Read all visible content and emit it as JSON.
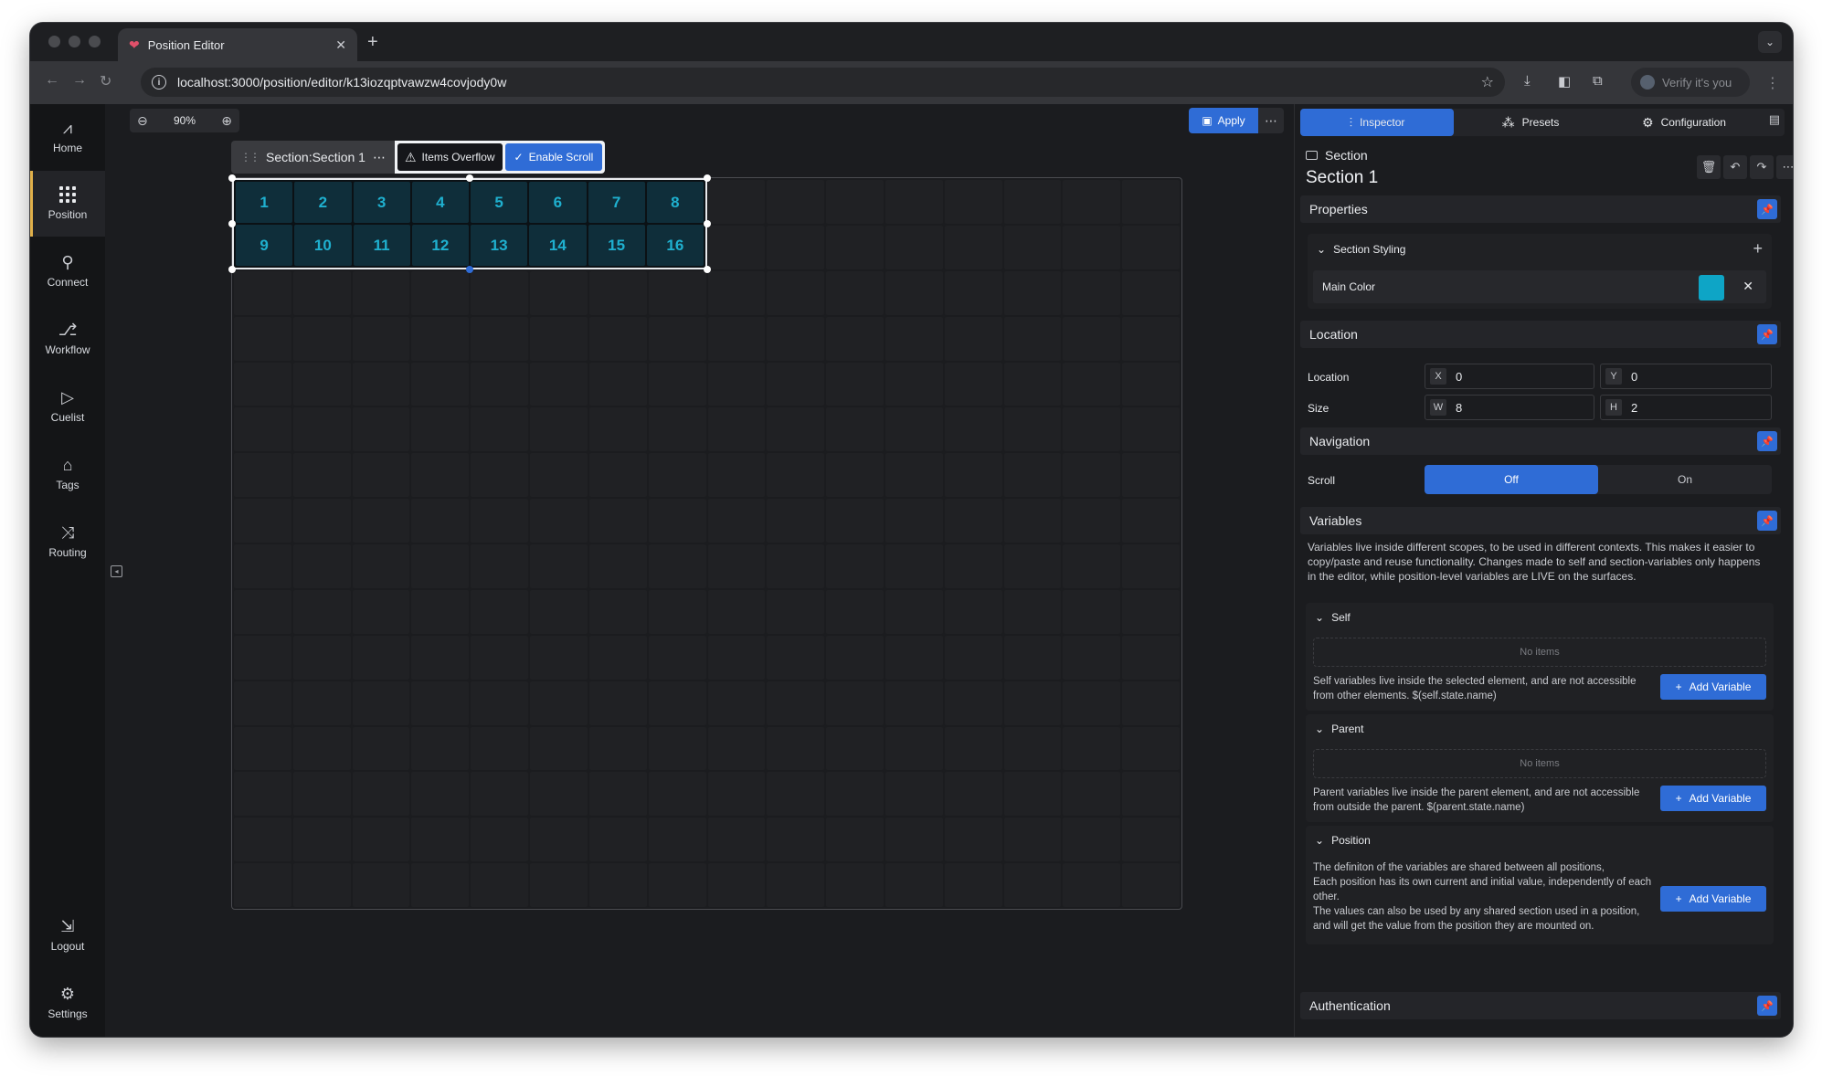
{
  "browser": {
    "tab_title": "Position Editor",
    "url": "localhost:3000/position/editor/k13iozqptvawzw4covjody0w",
    "verify_label": "Verify it's you"
  },
  "rail": {
    "items": [
      {
        "label": "Home",
        "icon": "pulse-icon"
      },
      {
        "label": "Position",
        "icon": "grid-icon"
      },
      {
        "label": "Connect",
        "icon": "plug-icon"
      },
      {
        "label": "Workflow",
        "icon": "workflow-icon"
      },
      {
        "label": "Cuelist",
        "icon": "play-icon"
      },
      {
        "label": "Tags",
        "icon": "tag-icon"
      },
      {
        "label": "Routing",
        "icon": "shuffle-icon"
      }
    ],
    "bottom": [
      {
        "label": "Logout",
        "icon": "logout-icon"
      },
      {
        "label": "Settings",
        "icon": "gear-icon"
      }
    ],
    "active": "Position",
    "active_color": "#e0b04a"
  },
  "canvas": {
    "zoom": "90%",
    "apply_label": "Apply",
    "section_label": "Section:Section 1",
    "items_overflow_label": "Items Overflow",
    "enable_scroll_label": "Enable Scroll",
    "grid_cols": 16,
    "grid_rows": 16,
    "cells": [
      "1",
      "2",
      "3",
      "4",
      "5",
      "6",
      "7",
      "8",
      "9",
      "10",
      "11",
      "12",
      "13",
      "14",
      "15",
      "16"
    ],
    "cell_color": "#1fb0cf"
  },
  "inspector": {
    "tabs": [
      {
        "label": "Inspector",
        "icon": "sliders-icon",
        "active": true
      },
      {
        "label": "Presets",
        "icon": "presets-icon",
        "active": false
      },
      {
        "label": "Configuration",
        "icon": "gear-icon",
        "active": false
      }
    ],
    "kind": "Section",
    "name": "Section 1",
    "properties_title": "Properties",
    "section_styling": "Section Styling",
    "main_color_label": "Main Color",
    "main_color": "#0ea5c6",
    "location_title": "Location",
    "location_label": "Location",
    "size_label": "Size",
    "x": "0",
    "y": "0",
    "w": "8",
    "h": "2",
    "navigation_title": "Navigation",
    "scroll_label": "Scroll",
    "scroll_off": "Off",
    "scroll_on": "On",
    "variables_title": "Variables",
    "variables_desc": "Variables live inside different scopes, to be used in different contexts. This makes it easier to copy/paste and reuse functionality. Changes made to self and section-variables only happens in the editor, while position-level variables are LIVE on the surfaces.",
    "self_title": "Self",
    "no_items": "No items",
    "self_note": "Self variables live inside the selected element, and are not accessible from other elements. $(self.state.name)",
    "parent_title": "Parent",
    "parent_note": "Parent variables live inside the parent element, and are not accessible from outside the parent. $(parent.state.name)",
    "position_title": "Position",
    "position_note_1": "The definiton of the variables are shared between all positions,",
    "position_note_2": "Each position has its own current and initial value, independently of each other.",
    "position_note_3": "The values can also be used by any shared section used in a position,",
    "position_note_4": "and will get the value from the position they are mounted on.",
    "add_variable": "Add Variable",
    "authentication_title": "Authentication",
    "accent": "#2f6cd6"
  }
}
